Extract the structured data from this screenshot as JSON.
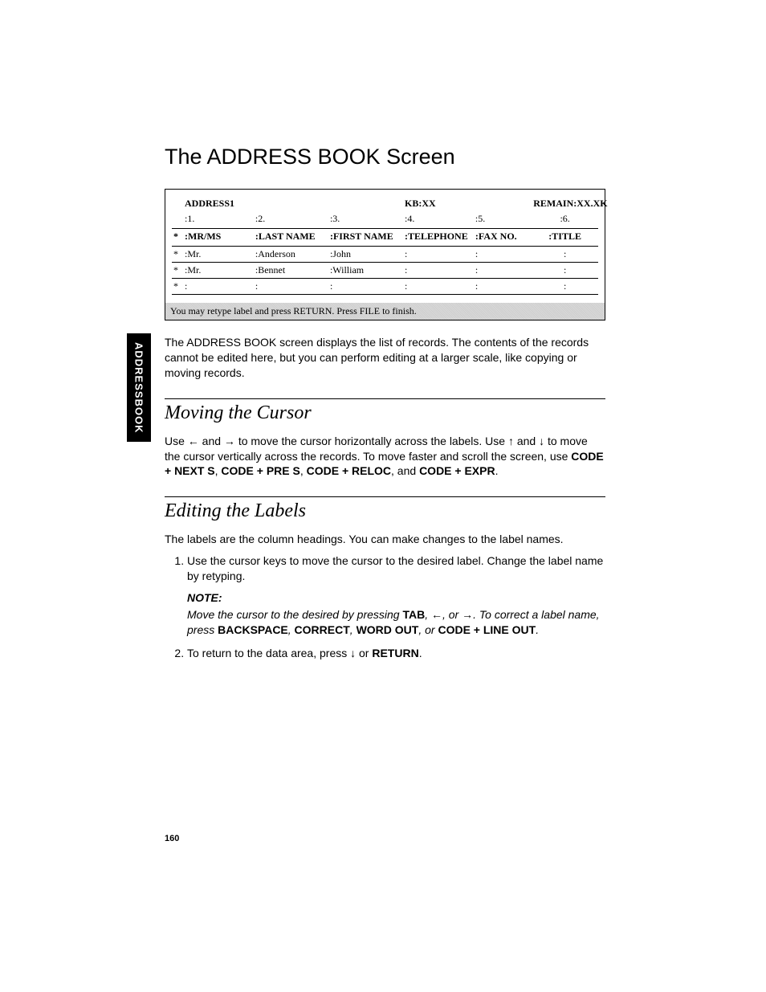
{
  "tab_label": "ADDRESSBOOK",
  "title": "The ADDRESS BOOK Screen",
  "page_number": "160",
  "screen": {
    "header": {
      "db": "ADDRESS1",
      "kb": "KB:XX",
      "remain": "REMAIN:XX.XK"
    },
    "col_nums": [
      ":1.",
      ":2.",
      ":3.",
      ":4.",
      ":5.",
      ":6."
    ],
    "col_labels": [
      ":MR/MS",
      ":LAST NAME",
      ":FIRST NAME",
      ":TELEPHONE",
      ":FAX NO.",
      ":TITLE"
    ],
    "rows": [
      {
        "bullet": "*",
        "cells": [
          ":Mr.",
          ":Anderson",
          ":John",
          ":",
          ":",
          ":"
        ]
      },
      {
        "bullet": "*",
        "cells": [
          ":Mr.",
          ":Bennet",
          ":William",
          ":",
          ":",
          ":"
        ]
      },
      {
        "bullet": "*",
        "cells": [
          ":",
          ":",
          ":",
          ":",
          ":",
          ":"
        ]
      }
    ],
    "status": "You may retype label and press RETURN.  Press FILE to finish."
  },
  "intro_para": "The ADDRESS BOOK screen displays the list of records. The contents of the records cannot be edited here, but you can perform editing at a larger scale, like copying or moving records.",
  "sec1": {
    "heading": "Moving the Cursor",
    "p_pre": "Use ← and → to move the cursor horizontally across the labels. Use ↑ and ↓ to move the cursor vertically across the records. To move faster and scroll the screen, use ",
    "k1": "CODE + NEXT S",
    "sep1": ", ",
    "k2": "CODE + PRE S",
    "sep2": ", ",
    "k3": "CODE + RELOC",
    "sep3": ", and ",
    "k4": "CODE + EXPR",
    "tail": "."
  },
  "sec2": {
    "heading": "Editing the Labels",
    "intro": "The labels are the column headings. You can make changes to the label names.",
    "step1": "Use the cursor keys to move the cursor to the desired label. Change the label name by retyping.",
    "note_label": "NOTE:",
    "note_pre": "Move the cursor to the desired by pressing ",
    "note_k1": "TAB",
    "note_mid1": ", ←, or →. To correct a label name, press ",
    "note_k2": "BACKSPACE",
    "note_c1": ", ",
    "note_k3": "CORRECT",
    "note_c2": ", ",
    "note_k4": "WORD OUT",
    "note_c3": ", or ",
    "note_k5": "CODE + LINE OUT",
    "note_tail": ".",
    "step2_pre": "To return to the data area, press ↓ or ",
    "step2_k": "RETURN",
    "step2_tail": "."
  }
}
